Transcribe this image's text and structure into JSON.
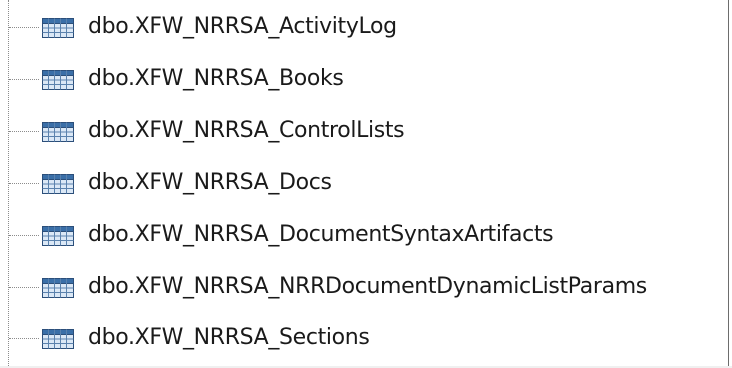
{
  "tree": {
    "items": [
      {
        "label": "dbo.XFW_NRRSA_ActivityLog",
        "icon": "table-icon"
      },
      {
        "label": "dbo.XFW_NRRSA_Books",
        "icon": "table-icon"
      },
      {
        "label": "dbo.XFW_NRRSA_ControlLists",
        "icon": "table-icon"
      },
      {
        "label": "dbo.XFW_NRRSA_Docs",
        "icon": "table-icon"
      },
      {
        "label": "dbo.XFW_NRRSA_DocumentSyntaxArtifacts",
        "icon": "table-icon"
      },
      {
        "label": "dbo.XFW_NRRSA_NRRDocumentDynamicListParams",
        "icon": "table-icon"
      },
      {
        "label": "dbo.XFW_NRRSA_Sections",
        "icon": "table-icon"
      }
    ]
  },
  "colors": {
    "icon_header": "#3a6fa8",
    "icon_cells": "#dbe8f6",
    "icon_border": "#2c4f7a",
    "text": "#1a1a1a",
    "tree_lines": "#8c8c8c"
  }
}
